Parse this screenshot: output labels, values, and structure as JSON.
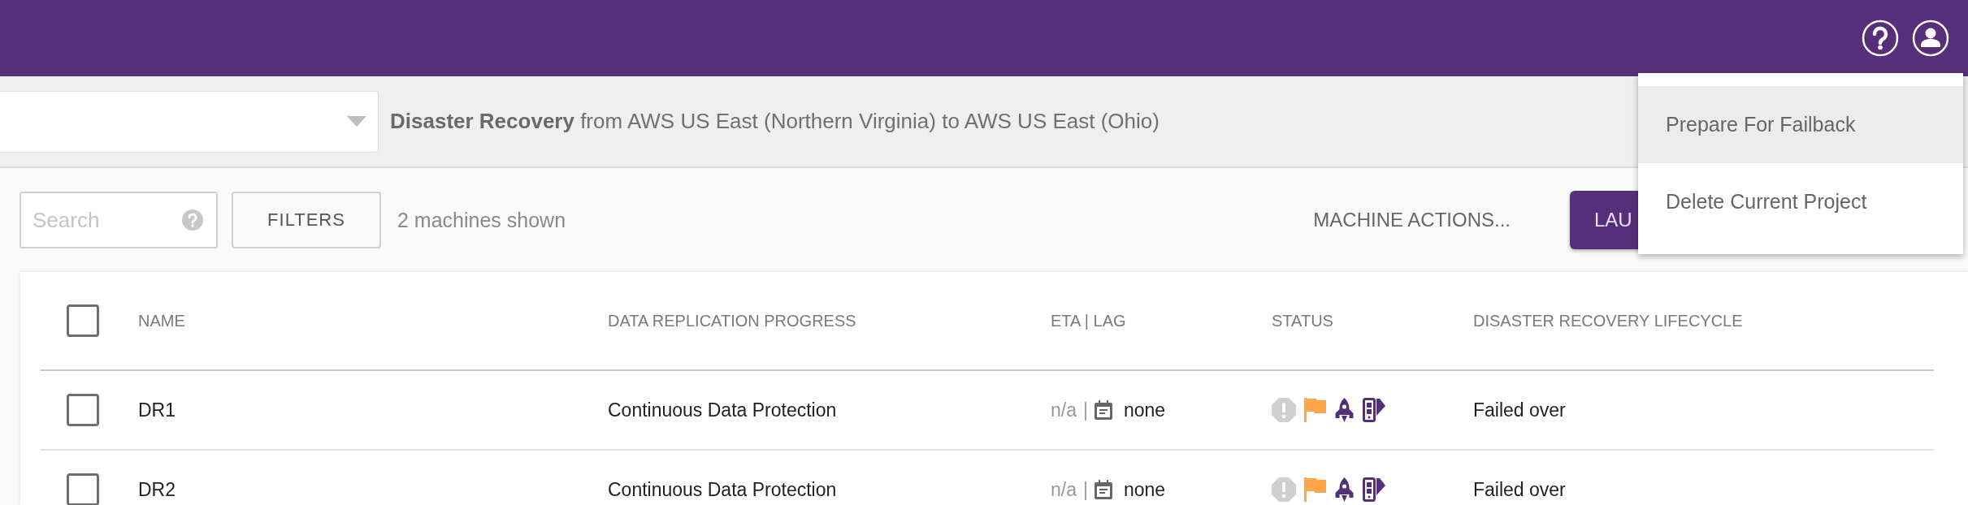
{
  "project_bar": {
    "title": "**Disaster Recovery** from AWS US East (Northern Virginia) to AWS US East (Ohio)"
  },
  "toolbar": {
    "search": {
      "placeholder": "Search"
    },
    "filters_button": "FILTERS",
    "count": "2 machines shown",
    "machine_actions": "MACHINE ACTIONS...",
    "launch_button": "LAU"
  },
  "table": {
    "select_all": {
      "checked": false
    },
    "columns": [
      "NAME",
      "DATA REPLICATION PROGRESS",
      "ETA | LAG",
      "STATUS",
      "DISASTER RECOVERY LIFECYCLE"
    ],
    "rows": [
      {
        "checked": false,
        "name": "DR1",
        "replication": "Continuous Data Protection",
        "eta": "n/a",
        "separator": "|",
        "lag": "none",
        "lifecycle": "Failed over"
      },
      {
        "checked": false,
        "name": "DR2",
        "replication": "Continuous Data Protection",
        "eta": "n/a",
        "separator": "|",
        "lag": "none",
        "lifecycle": "Failed over"
      }
    ]
  },
  "menu": {
    "items": [
      {
        "label": "Prepare For Failback",
        "selected": true
      },
      {
        "label": "Delete Current Project",
        "selected": false
      }
    ]
  }
}
